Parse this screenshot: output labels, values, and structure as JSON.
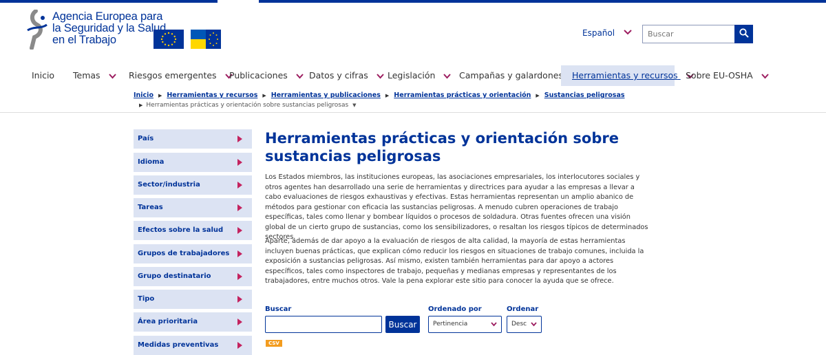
{
  "colors": {
    "primary": "#003399",
    "accent": "#9c1c5f",
    "sidebar_bg": "#dce3f3",
    "csv_badge": "#f39c1f"
  },
  "header": {
    "logo_lines": [
      "Agencia Europea para",
      "la Seguridad y la Salud",
      "en el Trabajo"
    ],
    "flags": [
      "eu-flag",
      "ukraine-flag"
    ],
    "language": "Español",
    "search_placeholder": "Buscar"
  },
  "nav": {
    "items": [
      {
        "label": "Inicio",
        "has_menu": false
      },
      {
        "label": "Temas",
        "has_menu": true
      },
      {
        "label": "Riesgos emergentes",
        "has_menu": true
      },
      {
        "label": "Publicaciones",
        "has_menu": true
      },
      {
        "label": "Datos y cifras",
        "has_menu": true
      },
      {
        "label": "Legislación",
        "has_menu": true
      },
      {
        "label": "Campañas y galardones",
        "has_menu": true
      },
      {
        "label": "Herramientas y recursos",
        "has_menu": true,
        "active": true
      },
      {
        "label": "Sobre EU-OSHA",
        "has_menu": true
      }
    ]
  },
  "breadcrumb": {
    "items": [
      "Inicio",
      "Herramientas y recursos",
      "Herramientas y publicaciones",
      "Herramientas prácticas y orientación",
      "Sustancias peligrosas"
    ],
    "current": "Herramientas prácticas y orientación sobre sustancias peligrosas"
  },
  "sidebar": {
    "filters": [
      "País",
      "Idioma",
      "Sector/industria",
      "Tareas",
      "Efectos sobre la salud",
      "Grupos de trabajadores",
      "Grupo destinatario",
      "Tipo",
      "Área prioritaria",
      "Medidas preventivas"
    ]
  },
  "main": {
    "title": "Herramientas prácticas y orientación sobre sustancias peligrosas",
    "paragraphs": [
      "Los Estados miembros, las instituciones europeas, las asociaciones empresariales, los interlocutores sociales y otros agentes han desarrollado una serie de herramientas y directrices para ayudar a las empresas a llevar a cabo evaluaciones de riesgos exhaustivas y efectivas. Estas herramientas representan un amplio abanico de métodos para gestionar con eficacia las sustancias peligrosas. A menudo cubren operaciones de trabajo específicas, tales como llenar y bombear líquidos o procesos de soldadura. Otras fuentes ofrecen una visión global de un cierto grupo de sustancias, como los sensibilizadores, o resaltan los riesgos típicos de determinados sectores.",
      "Aparte, además de dar apoyo a la evaluación de riesgos de alta calidad, la mayoría de estas herramientas incluyen buenas prácticas, que explican cómo reducir los riesgos en situaciones de trabajo comunes, incluida la exposición a sustancias peligrosas. Así mismo, existen también herramientas para dar apoyo a actores específicos, tales como inspectores de trabajo, pequeñas y medianas empresas y representantes de los trabajadores, entre muchos otros. Vale la pena explorar este sitio para conocer la ayuda que se ofrece."
    ]
  },
  "search_form": {
    "search_label": "Buscar",
    "search_value": "",
    "search_button": "Buscar",
    "sort_label": "Ordenado por",
    "sort_value": "Pertinencia",
    "order_label": "Ordenar",
    "order_value": "Desc",
    "csv_label": "CSV"
  }
}
